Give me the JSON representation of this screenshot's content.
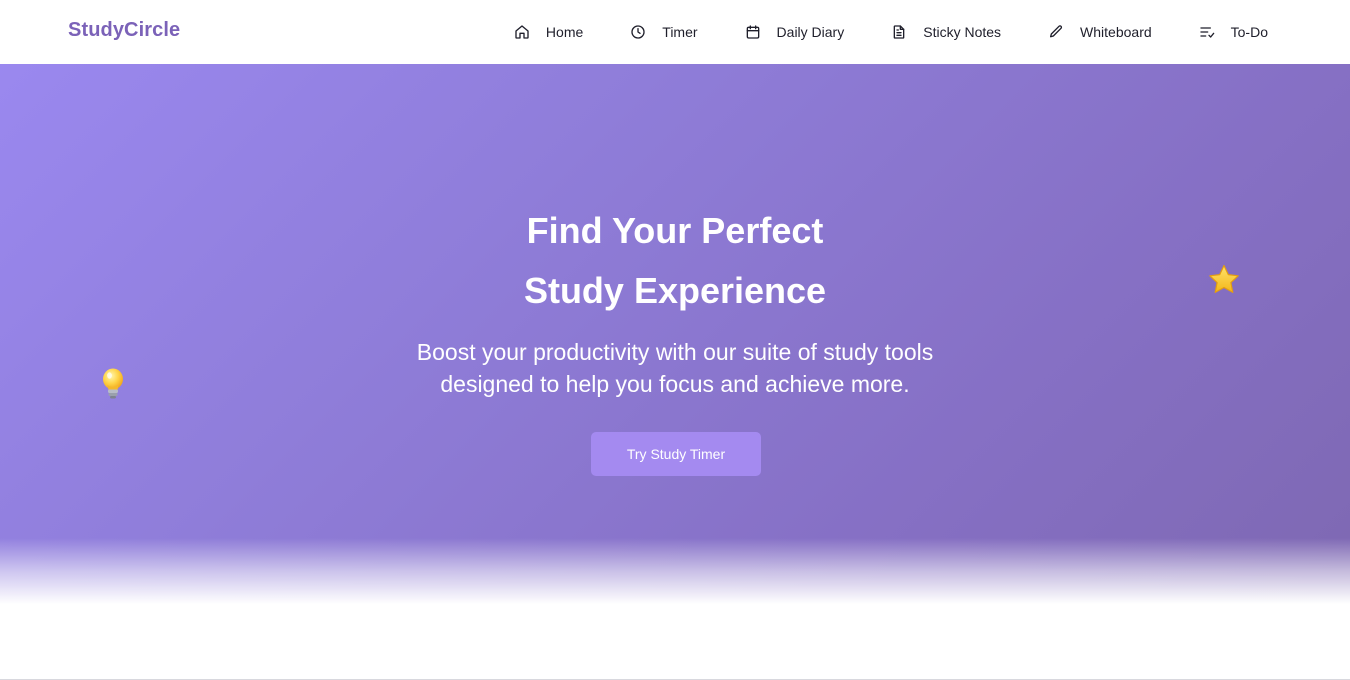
{
  "brand": {
    "name": "StudyCircle",
    "color": "#7b62b8"
  },
  "nav": {
    "items": [
      {
        "label": "Home",
        "icon": "home-icon"
      },
      {
        "label": "Timer",
        "icon": "clock-icon"
      },
      {
        "label": "Daily Diary",
        "icon": "calendar-icon"
      },
      {
        "label": "Sticky Notes",
        "icon": "document-icon"
      },
      {
        "label": "Whiteboard",
        "icon": "pencil-icon"
      },
      {
        "label": "To-Do",
        "icon": "list-check-icon"
      }
    ]
  },
  "hero": {
    "title_line1": "Find Your Perfect",
    "title_line2": "Study Experience",
    "subtitle_line1": "Boost your productivity with our suite of study tools",
    "subtitle_line2": "designed to help you focus and achieve more.",
    "cta_label": "Try Study Timer",
    "gradient_start": "#9a88ef",
    "gradient_end": "#7e68b2",
    "button_color": "#a48af0",
    "decorations": [
      "lightbulb-icon",
      "star-icon"
    ]
  }
}
